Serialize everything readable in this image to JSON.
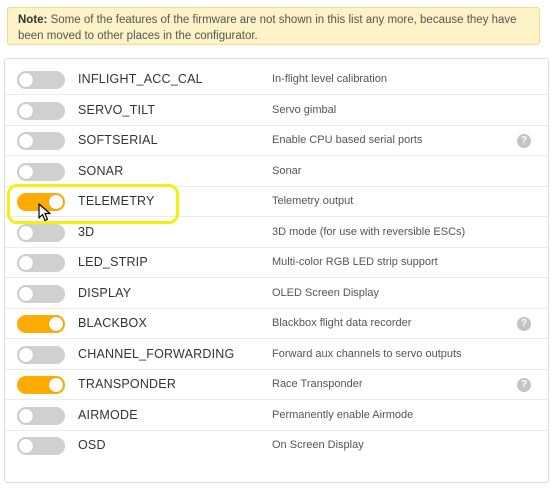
{
  "note": {
    "label": "Note:",
    "text": " Some of the features of the firmware are not shown in this list any more, because they have been moved to other places in the configurator."
  },
  "features": [
    {
      "name": "INFLIGHT_ACC_CAL",
      "description": "In-flight level calibration",
      "enabled": false,
      "help": false
    },
    {
      "name": "SERVO_TILT",
      "description": "Servo gimbal",
      "enabled": false,
      "help": false
    },
    {
      "name": "SOFTSERIAL",
      "description": "Enable CPU based serial ports",
      "enabled": false,
      "help": true
    },
    {
      "name": "SONAR",
      "description": "Sonar",
      "enabled": false,
      "help": false
    },
    {
      "name": "TELEMETRY",
      "description": "Telemetry output",
      "enabled": true,
      "help": false
    },
    {
      "name": "3D",
      "description": "3D mode (for use with reversible ESCs)",
      "enabled": false,
      "help": false
    },
    {
      "name": "LED_STRIP",
      "description": "Multi-color RGB LED strip support",
      "enabled": false,
      "help": false
    },
    {
      "name": "DISPLAY",
      "description": "OLED Screen Display",
      "enabled": false,
      "help": false
    },
    {
      "name": "BLACKBOX",
      "description": "Blackbox flight data recorder",
      "enabled": true,
      "help": true
    },
    {
      "name": "CHANNEL_FORWARDING",
      "description": "Forward aux channels to servo outputs",
      "enabled": false,
      "help": false
    },
    {
      "name": "TRANSPONDER",
      "description": "Race Transponder",
      "enabled": true,
      "help": true
    },
    {
      "name": "AIRMODE",
      "description": "Permanently enable Airmode",
      "enabled": false,
      "help": false
    },
    {
      "name": "OSD",
      "description": "On Screen Display",
      "enabled": false,
      "help": false
    }
  ],
  "help_icon_glyph": "?",
  "colors": {
    "toggle_on": "#ffab00",
    "toggle_off": "#d0d0d0",
    "highlight": "#f5ef10",
    "note_bg": "#fdf3c6"
  }
}
